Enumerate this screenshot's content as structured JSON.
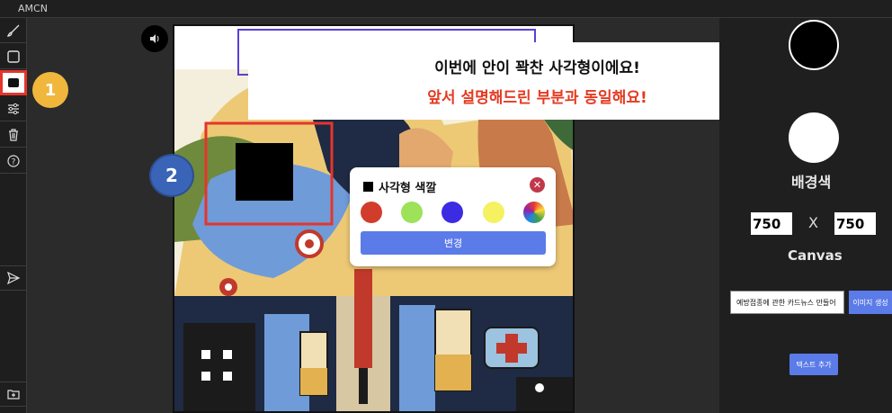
{
  "app": {
    "title": "AMCN"
  },
  "toolbar": {
    "items": [
      {
        "name": "brush-icon"
      },
      {
        "name": "rectangle-icon"
      },
      {
        "name": "filled-rectangle-icon"
      },
      {
        "name": "sliders-icon"
      },
      {
        "name": "trash-icon"
      },
      {
        "name": "help-icon"
      },
      {
        "name": "send-icon"
      },
      {
        "name": "folder-add-icon"
      }
    ]
  },
  "callout": {
    "line1": "이번에 안이 꽉찬 사각형이에요!",
    "line2": "앞서 설명해드린 부분과 동일해요!"
  },
  "badges": {
    "one": "1",
    "two": "2"
  },
  "color_popup": {
    "title": "사각형 색깔",
    "close": "✕",
    "swatches": [
      "#d23d2b",
      "#9de258",
      "#3b2be3",
      "#f5f160",
      "rainbow"
    ],
    "apply_label": "변경"
  },
  "right_panel": {
    "background_label": "배경색",
    "width_value": "750",
    "x_label": "X",
    "height_value": "750",
    "canvas_label": "Canvas",
    "prompt_value": "예방접종에 관한 카드뉴스 만들어",
    "generate_label": "이미지 생성",
    "add_text_label": "텍스트 추가"
  },
  "colors": {
    "accent": "#5b7be8",
    "highlight": "#e53a22",
    "badge_yellow": "#f0b73c",
    "badge_blue": "#3a64b8"
  }
}
